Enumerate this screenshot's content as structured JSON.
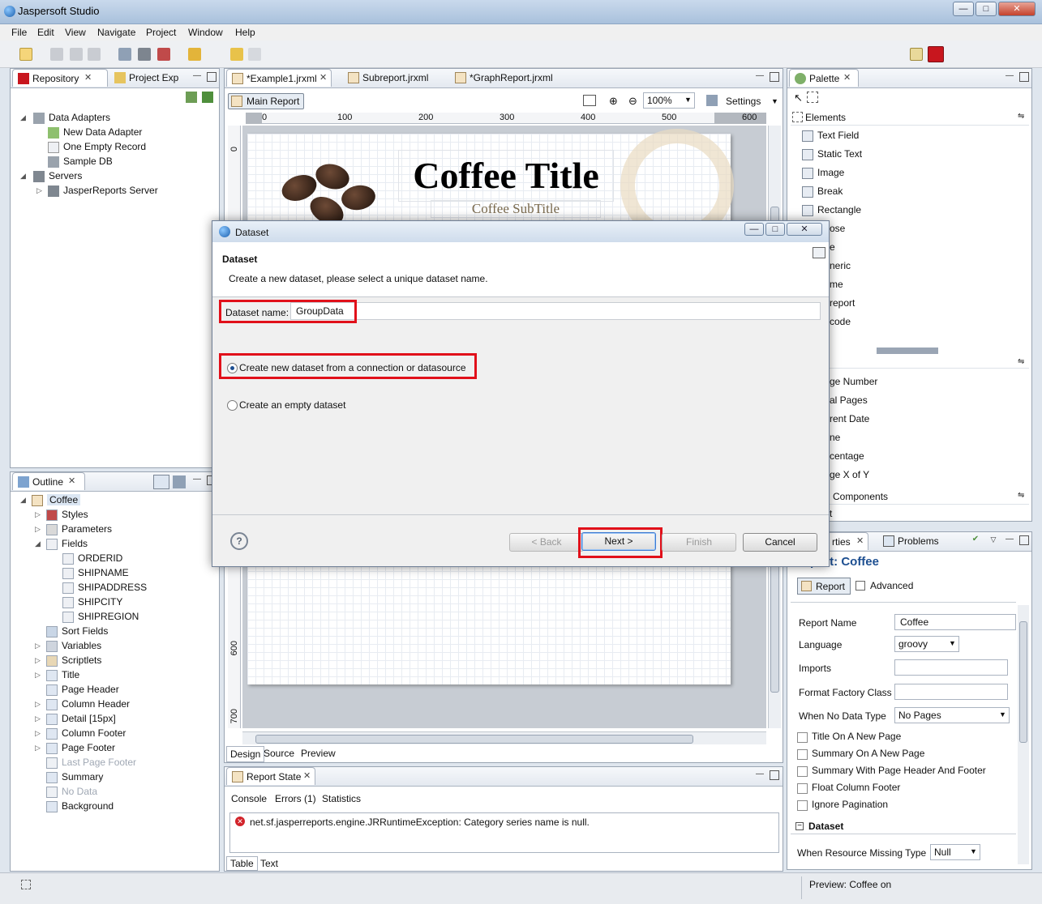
{
  "window": {
    "title": "Jaspersoft Studio"
  },
  "menu": [
    "File",
    "Edit",
    "View",
    "Navigate",
    "Project",
    "Window",
    "Help"
  ],
  "repository_panel": {
    "tabs": [
      "Repository",
      "Project Exp"
    ],
    "tree": [
      {
        "label": "Data Adapters",
        "level": 0
      },
      {
        "label": "New Data Adapter",
        "level": 1
      },
      {
        "label": "One Empty Record",
        "level": 1
      },
      {
        "label": "Sample DB",
        "level": 1
      },
      {
        "label": "Servers",
        "level": 0
      },
      {
        "label": "JasperReports Server",
        "level": 1
      }
    ]
  },
  "outline_panel": {
    "tab": "Outline",
    "root": "Coffee",
    "items": [
      {
        "label": "Styles",
        "level": 1
      },
      {
        "label": "Parameters",
        "level": 1
      },
      {
        "label": "Fields",
        "level": 1
      },
      {
        "label": "ORDERID",
        "level": 2
      },
      {
        "label": "SHIPNAME",
        "level": 2
      },
      {
        "label": "SHIPADDRESS",
        "level": 2
      },
      {
        "label": "SHIPCITY",
        "level": 2
      },
      {
        "label": "SHIPREGION",
        "level": 2
      },
      {
        "label": "Sort Fields",
        "level": 1
      },
      {
        "label": "Variables",
        "level": 1
      },
      {
        "label": "Scriptlets",
        "level": 1
      },
      {
        "label": "Title",
        "level": 1
      },
      {
        "label": "Page Header",
        "level": 1
      },
      {
        "label": "Column Header",
        "level": 1
      },
      {
        "label": "Detail [15px]",
        "level": 1
      },
      {
        "label": "Column Footer",
        "level": 1
      },
      {
        "label": "Page Footer",
        "level": 1
      },
      {
        "label": "Last Page Footer",
        "level": 1,
        "disabled": true
      },
      {
        "label": "Summary",
        "level": 1
      },
      {
        "label": "No Data",
        "level": 1,
        "disabled": true
      },
      {
        "label": "Background",
        "level": 1
      }
    ]
  },
  "editor": {
    "tabs": [
      "*Example1.jrxml",
      "Subreport.jrxml",
      "*GraphReport.jrxml"
    ],
    "main_report_label": "Main Report",
    "zoom": "100%",
    "settings_label": "Settings",
    "ruler_ticks": [
      "0",
      "100",
      "200",
      "300",
      "400",
      "500",
      "600"
    ],
    "vruler_ticks": [
      "0",
      "600",
      "700"
    ],
    "report_title": "Coffee Title",
    "report_subtitle": "Coffee SubTitle",
    "bottom_tabs": [
      "Design",
      "Source",
      "Preview"
    ]
  },
  "report_state": {
    "tab": "Report State",
    "subtabs": [
      "Console",
      "Errors (1)",
      "Statistics"
    ],
    "error": "net.sf.jasperreports.engine.JRRuntimeException: Category series name is null.",
    "bottom_tabs": [
      "Table",
      "Text"
    ]
  },
  "palette": {
    "tab": "Palette",
    "section": "Elements",
    "items": [
      "Text Field",
      "Static Text",
      "Image",
      "Break",
      "Rectangle",
      "ose",
      "e",
      "neric",
      "me",
      "report",
      "code"
    ],
    "items2": [
      "ge Number",
      "al Pages",
      "rent Date",
      "ne",
      "centage",
      "ge X of Y"
    ],
    "section3": "Components",
    "section3_item": "t"
  },
  "properties": {
    "tabs": [
      "rties",
      "Problems"
    ],
    "title": "port: Coffee",
    "subtabs": [
      "Report",
      "Advanced"
    ],
    "fields": {
      "report_name_label": "Report Name",
      "report_name": "Coffee",
      "language_label": "Language",
      "language": "groovy",
      "imports_label": "Imports",
      "format_factory_label": "Format Factory Class",
      "when_no_data_label": "When No Data Type",
      "when_no_data": "No Pages"
    },
    "checks": [
      "Title On A New Page",
      "Summary On A New Page",
      "Summary With Page Header And Footer",
      "Float Column Footer",
      "Ignore Pagination"
    ],
    "dataset_section": "Dataset",
    "missing_label": "When Resource Missing Type",
    "missing_value": "Null"
  },
  "dialog": {
    "window_title": "Dataset",
    "header_title": "Dataset",
    "header_desc": "Create a new dataset, please select a unique dataset name.",
    "name_label": "Dataset name:",
    "name_value": "GroupData",
    "option1": "Create new dataset from a connection or datasource",
    "option2": "Create an empty dataset",
    "buttons": {
      "back": "< Back",
      "next": "Next >",
      "finish": "Finish",
      "cancel": "Cancel"
    }
  },
  "status_bar": {
    "text": "Preview: Coffee on"
  }
}
